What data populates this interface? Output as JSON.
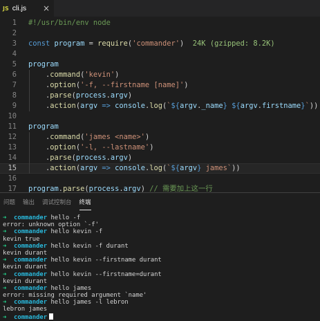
{
  "tab": {
    "icon": "JS",
    "filename": "cli.js",
    "close": "×"
  },
  "editor": {
    "lines": [
      {
        "n": "1",
        "code": [
          {
            "c": "cm",
            "t": "#!/usr/bin/env node"
          }
        ]
      },
      {
        "n": "2",
        "code": []
      },
      {
        "n": "3",
        "code": [
          {
            "c": "kw",
            "t": "const"
          },
          {
            "c": "op",
            "t": " "
          },
          {
            "c": "vr",
            "t": "program"
          },
          {
            "c": "op",
            "t": " = "
          },
          {
            "c": "fn",
            "t": "require"
          },
          {
            "c": "op",
            "t": "("
          },
          {
            "c": "st",
            "t": "'commander'"
          },
          {
            "c": "op",
            "t": ")  "
          },
          {
            "c": "badge",
            "t": "24K (gzipped: 8.2K)"
          }
        ]
      },
      {
        "n": "4",
        "code": []
      },
      {
        "n": "5",
        "code": [
          {
            "c": "vr",
            "t": "program"
          }
        ]
      },
      {
        "n": "6",
        "code": [
          {
            "c": "op",
            "t": "    ."
          },
          {
            "c": "fn",
            "t": "command"
          },
          {
            "c": "op",
            "t": "("
          },
          {
            "c": "st",
            "t": "'kevin'"
          },
          {
            "c": "op",
            "t": ")"
          }
        ]
      },
      {
        "n": "7",
        "code": [
          {
            "c": "op",
            "t": "    ."
          },
          {
            "c": "fn",
            "t": "option"
          },
          {
            "c": "op",
            "t": "("
          },
          {
            "c": "st",
            "t": "'-f, --firstname [name]'"
          },
          {
            "c": "op",
            "t": ")"
          }
        ]
      },
      {
        "n": "8",
        "code": [
          {
            "c": "op",
            "t": "    ."
          },
          {
            "c": "fn",
            "t": "parse"
          },
          {
            "c": "op",
            "t": "("
          },
          {
            "c": "vr",
            "t": "process"
          },
          {
            "c": "op",
            "t": "."
          },
          {
            "c": "vr",
            "t": "argv"
          },
          {
            "c": "op",
            "t": ")"
          }
        ]
      },
      {
        "n": "9",
        "code": [
          {
            "c": "op",
            "t": "    ."
          },
          {
            "c": "fn",
            "t": "action"
          },
          {
            "c": "op",
            "t": "("
          },
          {
            "c": "vr",
            "t": "argv"
          },
          {
            "c": "op",
            "t": " "
          },
          {
            "c": "kw",
            "t": "=>"
          },
          {
            "c": "op",
            "t": " "
          },
          {
            "c": "vr",
            "t": "console"
          },
          {
            "c": "op",
            "t": "."
          },
          {
            "c": "fn",
            "t": "log"
          },
          {
            "c": "op",
            "t": "("
          },
          {
            "c": "st",
            "t": "`"
          },
          {
            "c": "tq",
            "t": "${"
          },
          {
            "c": "vr",
            "t": "argv"
          },
          {
            "c": "op",
            "t": "."
          },
          {
            "c": "vr",
            "t": "_name"
          },
          {
            "c": "tq",
            "t": "}"
          },
          {
            "c": "st",
            "t": " "
          },
          {
            "c": "tq",
            "t": "${"
          },
          {
            "c": "vr",
            "t": "argv"
          },
          {
            "c": "op",
            "t": "."
          },
          {
            "c": "vr",
            "t": "firstname"
          },
          {
            "c": "tq",
            "t": "}"
          },
          {
            "c": "st",
            "t": "`"
          },
          {
            "c": "op",
            "t": "))"
          }
        ]
      },
      {
        "n": "10",
        "code": []
      },
      {
        "n": "11",
        "code": [
          {
            "c": "vr",
            "t": "program"
          }
        ]
      },
      {
        "n": "12",
        "code": [
          {
            "c": "op",
            "t": "    ."
          },
          {
            "c": "fn",
            "t": "command"
          },
          {
            "c": "op",
            "t": "("
          },
          {
            "c": "st",
            "t": "'james <name>'"
          },
          {
            "c": "op",
            "t": ")"
          }
        ]
      },
      {
        "n": "13",
        "code": [
          {
            "c": "op",
            "t": "    ."
          },
          {
            "c": "fn",
            "t": "option"
          },
          {
            "c": "op",
            "t": "("
          },
          {
            "c": "st",
            "t": "'-l, --lastname'"
          },
          {
            "c": "op",
            "t": ")"
          }
        ]
      },
      {
        "n": "14",
        "code": [
          {
            "c": "op",
            "t": "    ."
          },
          {
            "c": "fn",
            "t": "parse"
          },
          {
            "c": "op",
            "t": "("
          },
          {
            "c": "vr",
            "t": "process"
          },
          {
            "c": "op",
            "t": "."
          },
          {
            "c": "vr",
            "t": "argv"
          },
          {
            "c": "op",
            "t": ")"
          }
        ]
      },
      {
        "n": "15",
        "code": [
          {
            "c": "op",
            "t": "    ."
          },
          {
            "c": "fn",
            "t": "action"
          },
          {
            "c": "op",
            "t": "("
          },
          {
            "c": "vr",
            "t": "argv"
          },
          {
            "c": "op",
            "t": " "
          },
          {
            "c": "kw",
            "t": "=>"
          },
          {
            "c": "op",
            "t": " "
          },
          {
            "c": "vr",
            "t": "console"
          },
          {
            "c": "op",
            "t": "."
          },
          {
            "c": "fn",
            "t": "log"
          },
          {
            "c": "op",
            "t": "("
          },
          {
            "c": "st",
            "t": "`"
          },
          {
            "c": "tq",
            "t": "${"
          },
          {
            "c": "vr",
            "t": "argv"
          },
          {
            "c": "tq",
            "t": "}"
          },
          {
            "c": "st",
            "t": " james`"
          },
          {
            "c": "op",
            "t": "))"
          }
        ]
      },
      {
        "n": "16",
        "code": []
      },
      {
        "n": "17",
        "code": [
          {
            "c": "vr",
            "t": "program"
          },
          {
            "c": "op",
            "t": "."
          },
          {
            "c": "fn",
            "t": "parse"
          },
          {
            "c": "op",
            "t": "("
          },
          {
            "c": "vr",
            "t": "process"
          },
          {
            "c": "op",
            "t": "."
          },
          {
            "c": "vr",
            "t": "argv"
          },
          {
            "c": "op",
            "t": ") "
          },
          {
            "c": "cm",
            "t": "// 需要加上这一行"
          }
        ]
      }
    ]
  },
  "panel": {
    "tabs": [
      "问题",
      "输出",
      "调试控制台",
      "终端"
    ],
    "active_tab": "终端",
    "terminal": [
      {
        "prompt": true,
        "cmd": "hello -f"
      },
      {
        "prompt": false,
        "text": "error: unknown option `-f'"
      },
      {
        "prompt": true,
        "cmd": "hello kevin -f"
      },
      {
        "prompt": false,
        "text": "kevin true"
      },
      {
        "prompt": true,
        "cmd": "hello kevin -f durant"
      },
      {
        "prompt": false,
        "text": "kevin durant"
      },
      {
        "prompt": true,
        "cmd": "hello kevin --firstname durant"
      },
      {
        "prompt": false,
        "text": "kevin durant"
      },
      {
        "prompt": true,
        "cmd": "hello kevin --firstname=durant"
      },
      {
        "prompt": false,
        "text": "kevin durant"
      },
      {
        "prompt": true,
        "cmd": "hello james"
      },
      {
        "prompt": false,
        "text": "error: missing required argument `name'"
      },
      {
        "prompt": true,
        "cmd": "hello james -l lebron"
      },
      {
        "prompt": false,
        "text": "lebron james"
      },
      {
        "prompt": true,
        "cmd": "",
        "cursor": true
      }
    ],
    "prompt_arrow": "➜",
    "prompt_dir": "commander"
  },
  "colors": {
    "background": "#1e1e1e",
    "accent_green": "#23d18b",
    "accent_cyan": "#29b8db"
  }
}
